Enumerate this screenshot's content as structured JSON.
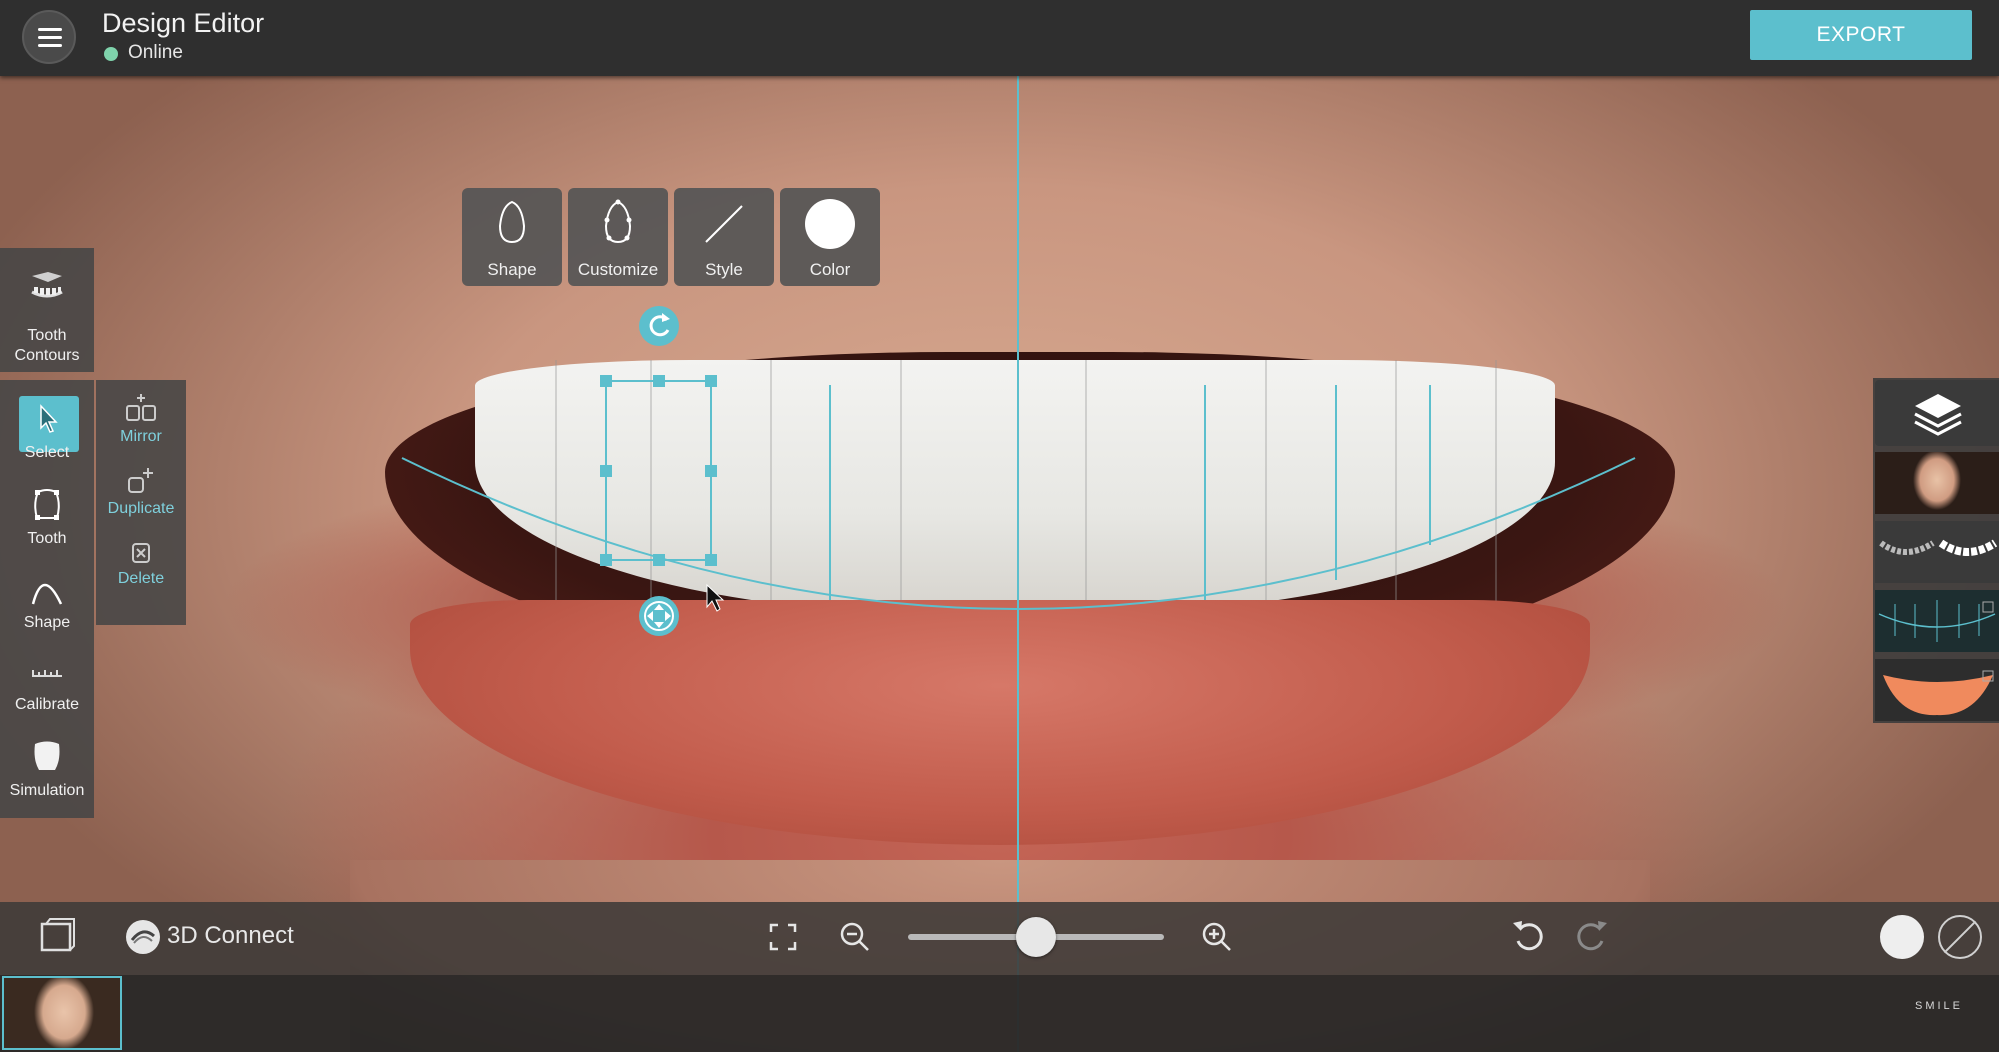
{
  "header": {
    "title": "Design Editor",
    "status": "Online",
    "export_label": "EXPORT",
    "menu_icon": "hamburger-menu-icon"
  },
  "left_toolbar": {
    "contours": {
      "label_line1": "Tooth",
      "label_line2": "Contours",
      "icon": "tooth-contours-icon"
    },
    "tools": [
      {
        "label": "Select",
        "icon": "cursor-icon",
        "active": true
      },
      {
        "label": "Tooth",
        "icon": "tooth-outline-icon"
      },
      {
        "label": "Shape",
        "icon": "shape-curve-icon"
      },
      {
        "label": "Calibrate",
        "icon": "ruler-icon"
      },
      {
        "label": "Simulation",
        "icon": "simulation-tooth-icon"
      }
    ],
    "sub_tools": [
      {
        "label": "Mirror",
        "icon": "mirror-icon"
      },
      {
        "label": "Duplicate",
        "icon": "duplicate-icon"
      },
      {
        "label": "Delete",
        "icon": "delete-icon"
      }
    ]
  },
  "floating_toolbar": [
    {
      "label": "Shape",
      "icon": "tooth-shape-icon"
    },
    {
      "label": "Customize",
      "icon": "customize-outline-icon"
    },
    {
      "label": "Style",
      "icon": "style-line-icon"
    },
    {
      "label": "Color",
      "icon": "color-circle-icon"
    }
  ],
  "layers_panel": {
    "icon": "layers-icon",
    "items": [
      "face-photo-layer",
      "teeth-library-layer",
      "smile-grid-layer",
      "lip-mask-layer"
    ]
  },
  "bottom_bar": {
    "connect_label": "3D Connect",
    "brand": "SMILE",
    "zoom_level": 0.5,
    "icons": [
      "gallery-icon",
      "3d-connect-icon",
      "fullscreen-icon",
      "zoom-out-icon",
      "zoom-in-icon",
      "undo-icon",
      "redo-icon",
      "white-color-swatch-icon",
      "no-color-icon"
    ]
  },
  "colors": {
    "accent": "#5cbfcd",
    "topbar": "#2f2f2f",
    "status_online": "#7fd3ac"
  }
}
